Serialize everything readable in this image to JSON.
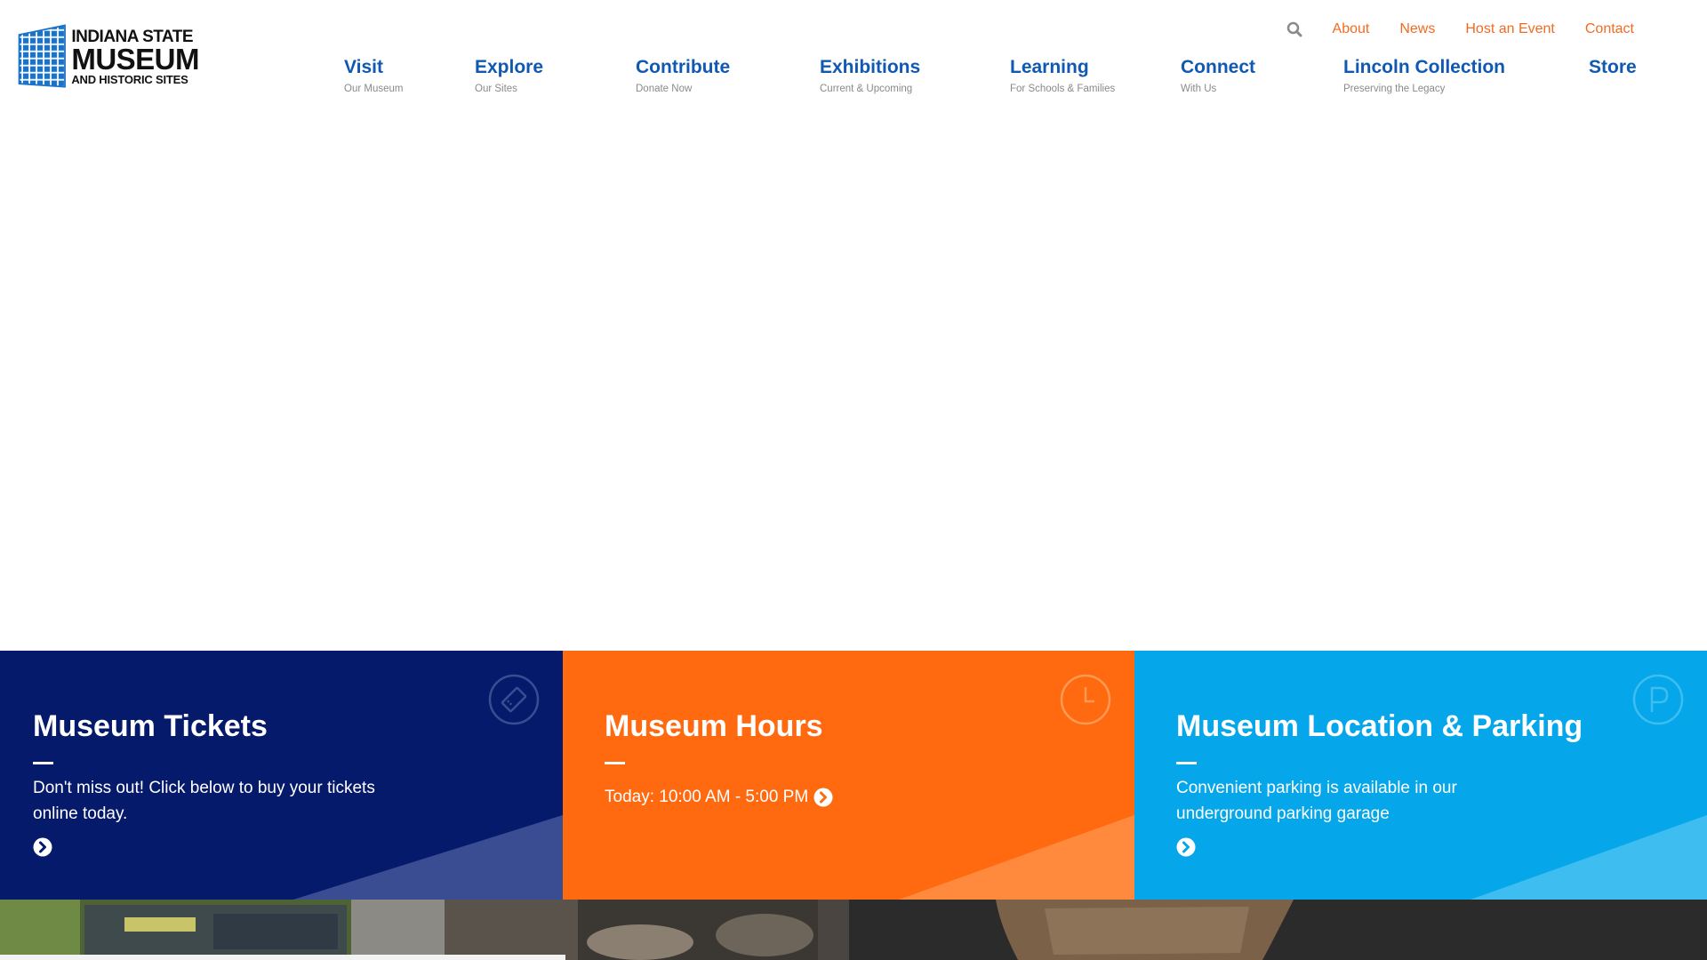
{
  "logo": {
    "line1": "INDIANA STATE",
    "line2": "MUSEUM",
    "line3": "AND HISTORIC SITES",
    "color": "#1a73c8"
  },
  "utility_nav": {
    "search_icon": "search-icon",
    "items": [
      "About",
      "News",
      "Host an Event",
      "Contact"
    ],
    "color": "#f26b21"
  },
  "main_nav": [
    {
      "title": "Visit",
      "subtitle": "Our Museum"
    },
    {
      "title": "Explore",
      "subtitle": "Our Sites"
    },
    {
      "title": "Contribute",
      "subtitle": "Donate Now"
    },
    {
      "title": "Exhibitions",
      "subtitle": "Current & Upcoming"
    },
    {
      "title": "Learning",
      "subtitle": "For Schools & Families"
    },
    {
      "title": "Connect",
      "subtitle": "With Us"
    },
    {
      "title": "Lincoln Collection",
      "subtitle": "Preserving the Legacy"
    },
    {
      "title": "Store",
      "subtitle": ""
    }
  ],
  "panels": {
    "tickets": {
      "title": "Museum Tickets",
      "text": "Don't miss out! Click below to buy your tickets online today.",
      "icon": "ticket-icon",
      "color": "#061a6b"
    },
    "hours": {
      "title": "Museum Hours",
      "text": "Today: 10:00 AM - 5:00 PM",
      "icon": "clock-icon",
      "color": "#ff6a10"
    },
    "parking": {
      "title": "Museum Location & Parking",
      "text": "Convenient parking is available in our underground parking garage",
      "icon": "parking-icon",
      "color": "#05a7ea"
    }
  }
}
